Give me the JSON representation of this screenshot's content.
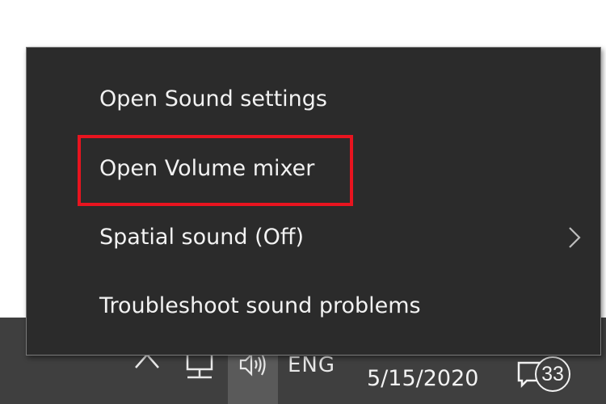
{
  "menu": {
    "items": [
      {
        "label": "Open Sound settings",
        "has_submenu": false
      },
      {
        "label": "Open Volume mixer",
        "has_submenu": false,
        "highlighted": true
      },
      {
        "label": "Spatial sound (Off)",
        "has_submenu": true
      },
      {
        "label": "Troubleshoot sound problems",
        "has_submenu": false
      }
    ],
    "highlight_color": "#e8141f",
    "background_color": "#2b2b2b"
  },
  "taskbar": {
    "icons": [
      "chevron-up-icon",
      "network-icon",
      "speaker-icon"
    ],
    "language": "ENG",
    "date": "5/15/2020",
    "notification_count": "33",
    "background_color": "#3f3f3f"
  }
}
